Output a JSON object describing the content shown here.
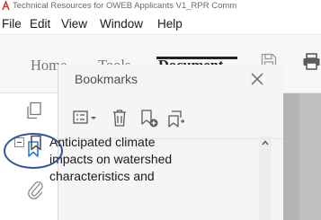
{
  "window": {
    "title": "Technical Resources for OWEB Applicants V1_RPR Comm"
  },
  "menu": {
    "items": [
      "File",
      "Edit",
      "View",
      "Window",
      "Help"
    ]
  },
  "toolbar": {
    "tabs": [
      "Home",
      "Tools",
      "Document"
    ],
    "active_tab": "Document",
    "icons": [
      "save-icon",
      "print-icon"
    ]
  },
  "nav_rail": {
    "icons": [
      "pages-icon",
      "bookmark-icon",
      "attachments-icon"
    ],
    "highlighted": "bookmark-icon"
  },
  "bookmarks_panel": {
    "title": "Bookmarks",
    "close_glyph": "✕",
    "tools": [
      "options-menu-icon",
      "delete-bookmark-icon",
      "new-bookmark-icon",
      "expand-bookmark-icon"
    ],
    "items": [
      {
        "label": "Anticipated climate impacts on watershed characteristics and",
        "expanded": true
      }
    ]
  },
  "colors": {
    "annotation_circle": "#2f5597",
    "app_icon": "#d83b22",
    "document_background": "#b4b4b4"
  }
}
